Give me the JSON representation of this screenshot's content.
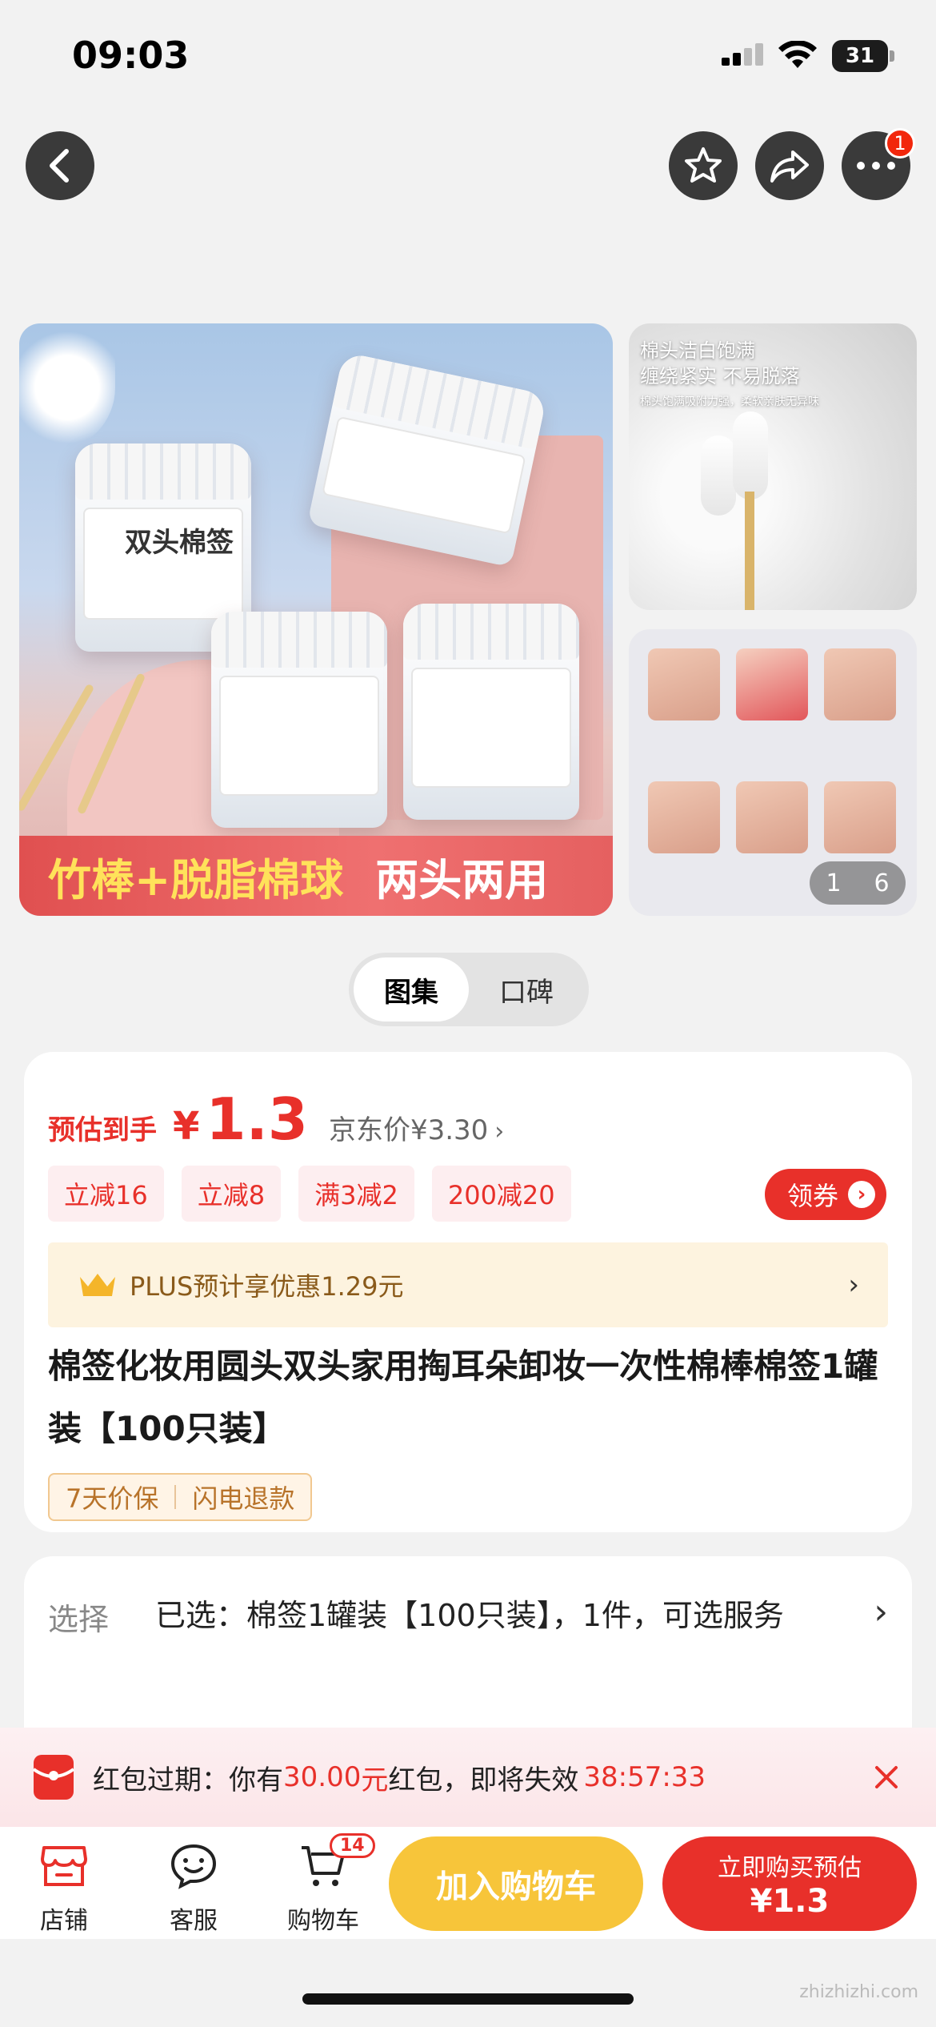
{
  "status": {
    "time": "09:03",
    "battery": "31"
  },
  "top": {
    "more_badge": "1"
  },
  "gallery": {
    "main_banner_a": "竹棒+脱脂棉球",
    "main_banner_b": "两头两用",
    "jar_name": "双头棉签",
    "side_text_1": "棉头洁白饱满",
    "side_text_2": "缠绕紧实 不易脱落",
    "side_text_3": "棉头饱满吸附力强，柔软亲肤无异味",
    "counter_current": "1",
    "counter_total": "6"
  },
  "segment": {
    "tab1": "图集",
    "tab2": "口碑"
  },
  "price": {
    "est_label": "预估到手",
    "currency": "¥",
    "est_value": "1.3",
    "jd_price": "京东价¥3.30",
    "coupons": [
      "立减16",
      "立减8",
      "满3减2",
      "200减20"
    ],
    "get_coupon": "领券",
    "plus_text": "PLUS预计享优惠1.29元",
    "title": "棉签化妆用圆头双头家用掏耳朵卸妆一次性棉棒棉签1罐装【100只装】",
    "tags": [
      "7天价保",
      "闪电退款"
    ]
  },
  "select": {
    "label": "选择",
    "value": "已选：棉签1罐装【100只装】，1件，可选服务"
  },
  "red_packet": {
    "prefix": "红包过期：你有",
    "amount": "30.00",
    "unit": "元",
    "middle": "红包，即将失效",
    "countdown": "38:57:33"
  },
  "tabbar": {
    "shop": "店铺",
    "service": "客服",
    "cart": "购物车",
    "cart_count": "14",
    "add_cart": "加入购物车",
    "buy_now": "立即购买预估",
    "buy_price": "¥1.3"
  },
  "watermark": {
    "text": "zhizhizhi.com"
  },
  "colors": {
    "accent": "#e8302a",
    "yellow": "#f7c53a",
    "gold": "#8a5a1a"
  }
}
